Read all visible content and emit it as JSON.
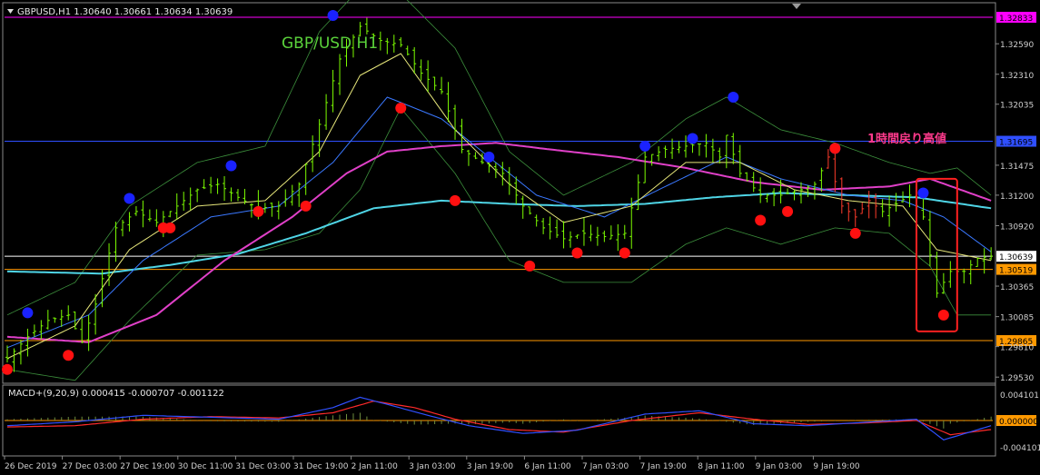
{
  "chart_data": {
    "type": "candlestick",
    "symbol_header": "GBPUSD,H1  1.30640 1.30661 1.30634 1.30639",
    "watermark": "GBP/USD H1",
    "annotation": "1時間戻り高値",
    "ylim": [
      1.2949,
      1.3295
    ],
    "price_ticks": [
      "1.32590",
      "1.32310",
      "1.32035",
      "1.31475",
      "1.31200",
      "1.30920",
      "1.30365",
      "1.30085",
      "1.29810",
      "1.29530"
    ],
    "x_ticks": [
      "26 Dec 2019",
      "27 Dec 03:00",
      "27 Dec 19:00",
      "30 Dec 11:00",
      "31 Dec 03:00",
      "31 Dec 19:00",
      "2 Jan 11:00",
      "3 Jan 03:00",
      "3 Jan 19:00",
      "6 Jan 11:00",
      "7 Jan 03:00",
      "7 Jan 19:00",
      "8 Jan 11:00",
      "9 Jan 03:00",
      "9 Jan 19:00"
    ],
    "horizontal_levels": [
      {
        "label": "1.32833",
        "price": 1.32833,
        "color": "#ff00ff"
      },
      {
        "label": "1.31695",
        "price": 1.31695,
        "color": "#2f4fff"
      },
      {
        "label": "1.30639",
        "price": 1.30639,
        "color": "#ffffff"
      },
      {
        "label": "1.30519",
        "price": 1.30519,
        "color": "#ff9900"
      },
      {
        "label": "1.29865",
        "price": 1.29865,
        "color": "#ff9900"
      }
    ],
    "close_path": [
      [
        0,
        1.297
      ],
      [
        3,
        1.299
      ],
      [
        6,
        1.3005
      ],
      [
        9,
        1.301
      ],
      [
        11,
        1.2985
      ],
      [
        13,
        1.302
      ],
      [
        16,
        1.309
      ],
      [
        19,
        1.3105
      ],
      [
        22,
        1.3095
      ],
      [
        25,
        1.311
      ],
      [
        28,
        1.3125
      ],
      [
        31,
        1.313
      ],
      [
        34,
        1.3118
      ],
      [
        37,
        1.3108
      ],
      [
        40,
        1.311
      ],
      [
        43,
        1.313
      ],
      [
        46,
        1.3185
      ],
      [
        49,
        1.3245
      ],
      [
        52,
        1.3275
      ],
      [
        55,
        1.3262
      ],
      [
        58,
        1.3258
      ],
      [
        61,
        1.3232
      ],
      [
        64,
        1.3215
      ],
      [
        67,
        1.3162
      ],
      [
        70,
        1.315
      ],
      [
        73,
        1.314
      ],
      [
        76,
        1.311
      ],
      [
        79,
        1.309
      ],
      [
        82,
        1.308
      ],
      [
        85,
        1.3085
      ],
      [
        88,
        1.3082
      ],
      [
        91,
        1.3085
      ],
      [
        94,
        1.3155
      ],
      [
        97,
        1.3162
      ],
      [
        100,
        1.3165
      ],
      [
        103,
        1.3168
      ],
      [
        105,
        1.3155
      ],
      [
        106,
        1.3175
      ],
      [
        108,
        1.314
      ],
      [
        111,
        1.312
      ],
      [
        114,
        1.312
      ],
      [
        117,
        1.3125
      ],
      [
        119,
        1.313
      ],
      [
        121,
        1.3155
      ],
      [
        123,
        1.311
      ],
      [
        125,
        1.31
      ],
      [
        127,
        1.3115
      ],
      [
        129,
        1.3105
      ],
      [
        131,
        1.3112
      ],
      [
        133,
        1.312
      ],
      [
        135,
        1.31
      ],
      [
        137,
        1.303
      ],
      [
        139,
        1.305
      ],
      [
        141,
        1.305
      ],
      [
        143,
        1.3062
      ],
      [
        145,
        1.3064
      ]
    ],
    "ma_fast": [
      [
        0,
        1.297
      ],
      [
        10,
        1.3
      ],
      [
        18,
        1.307
      ],
      [
        28,
        1.311
      ],
      [
        38,
        1.3115
      ],
      [
        46,
        1.316
      ],
      [
        52,
        1.323
      ],
      [
        58,
        1.325
      ],
      [
        66,
        1.318
      ],
      [
        74,
        1.313
      ],
      [
        82,
        1.3095
      ],
      [
        92,
        1.311
      ],
      [
        100,
        1.315
      ],
      [
        108,
        1.315
      ],
      [
        116,
        1.3125
      ],
      [
        124,
        1.3115
      ],
      [
        132,
        1.311
      ],
      [
        137,
        1.307
      ],
      [
        145,
        1.306
      ]
    ],
    "ma_blue": [
      [
        0,
        1.298
      ],
      [
        12,
        1.301
      ],
      [
        20,
        1.306
      ],
      [
        30,
        1.31
      ],
      [
        40,
        1.311
      ],
      [
        48,
        1.315
      ],
      [
        56,
        1.321
      ],
      [
        64,
        1.319
      ],
      [
        70,
        1.316
      ],
      [
        78,
        1.312
      ],
      [
        88,
        1.31
      ],
      [
        96,
        1.3125
      ],
      [
        106,
        1.3155
      ],
      [
        114,
        1.3135
      ],
      [
        124,
        1.312
      ],
      [
        132,
        1.3115
      ],
      [
        138,
        1.31
      ],
      [
        145,
        1.3068
      ]
    ],
    "ma_magenta": [
      [
        0,
        1.299
      ],
      [
        12,
        1.2985
      ],
      [
        22,
        1.301
      ],
      [
        32,
        1.306
      ],
      [
        42,
        1.31
      ],
      [
        50,
        1.314
      ],
      [
        56,
        1.316
      ],
      [
        64,
        1.3165
      ],
      [
        72,
        1.3168
      ],
      [
        80,
        1.3162
      ],
      [
        90,
        1.3155
      ],
      [
        100,
        1.3145
      ],
      [
        110,
        1.3132
      ],
      [
        120,
        1.3125
      ],
      [
        130,
        1.3128
      ],
      [
        136,
        1.3135
      ],
      [
        145,
        1.3115
      ]
    ],
    "ma_cyan": [
      [
        0,
        1.305
      ],
      [
        14,
        1.3048
      ],
      [
        24,
        1.3056
      ],
      [
        34,
        1.3066
      ],
      [
        44,
        1.3085
      ],
      [
        54,
        1.3108
      ],
      [
        64,
        1.3115
      ],
      [
        74,
        1.3112
      ],
      [
        84,
        1.311
      ],
      [
        94,
        1.3112
      ],
      [
        104,
        1.3118
      ],
      [
        114,
        1.3122
      ],
      [
        124,
        1.312
      ],
      [
        134,
        1.3118
      ],
      [
        145,
        1.3108
      ]
    ],
    "bb_upper": [
      [
        0,
        1.301
      ],
      [
        10,
        1.304
      ],
      [
        18,
        1.311
      ],
      [
        28,
        1.315
      ],
      [
        38,
        1.3165
      ],
      [
        46,
        1.327
      ],
      [
        52,
        1.331
      ],
      [
        58,
        1.3305
      ],
      [
        66,
        1.3255
      ],
      [
        74,
        1.316
      ],
      [
        82,
        1.312
      ],
      [
        92,
        1.315
      ],
      [
        100,
        1.319
      ],
      [
        106,
        1.321
      ],
      [
        114,
        1.318
      ],
      [
        122,
        1.3168
      ],
      [
        130,
        1.315
      ],
      [
        136,
        1.314
      ],
      [
        140,
        1.3145
      ],
      [
        145,
        1.312
      ]
    ],
    "bb_lower": [
      [
        0,
        1.296
      ],
      [
        10,
        1.295
      ],
      [
        18,
        1.3005
      ],
      [
        28,
        1.3065
      ],
      [
        38,
        1.307
      ],
      [
        46,
        1.3085
      ],
      [
        52,
        1.3125
      ],
      [
        58,
        1.32
      ],
      [
        66,
        1.314
      ],
      [
        74,
        1.306
      ],
      [
        82,
        1.304
      ],
      [
        92,
        1.304
      ],
      [
        100,
        1.3075
      ],
      [
        106,
        1.309
      ],
      [
        114,
        1.3075
      ],
      [
        122,
        1.309
      ],
      [
        130,
        1.3085
      ],
      [
        136,
        1.3055
      ],
      [
        140,
        1.301
      ],
      [
        145,
        1.301
      ]
    ],
    "swing_highs": [
      [
        3,
        1.3012
      ],
      [
        18,
        1.3117
      ],
      [
        33,
        1.3147
      ],
      [
        48,
        1.3285
      ],
      [
        71,
        1.3155
      ],
      [
        94,
        1.3165
      ],
      [
        101,
        1.3172
      ],
      [
        107,
        1.321
      ],
      [
        122,
        1.3163
      ],
      [
        135,
        1.3122
      ]
    ],
    "swing_lows": [
      [
        0,
        1.296
      ],
      [
        9,
        1.2973
      ],
      [
        23,
        1.309
      ],
      [
        24,
        1.309
      ],
      [
        37,
        1.3105
      ],
      [
        44,
        1.311
      ],
      [
        58,
        1.32
      ],
      [
        66,
        1.3115
      ],
      [
        77,
        1.3055
      ],
      [
        84,
        1.3067
      ],
      [
        91,
        1.3067
      ],
      [
        111,
        1.3097
      ],
      [
        115,
        1.3105
      ],
      [
        122,
        1.3163
      ],
      [
        125,
        1.3085
      ],
      [
        138,
        1.301
      ]
    ],
    "highlight_box": {
      "x_from": 134,
      "x_to": 140,
      "p_from": 1.3135,
      "p_to": 1.2995,
      "color": "#ff2020"
    },
    "macd": {
      "label": "MACD+(9,20,9) 0.000415 -0.000707 -0.001122",
      "ticks": [
        "0.004101",
        "0.000000",
        "-0.004101"
      ],
      "ylim": [
        -0.0052,
        0.0052
      ],
      "macd_line": [
        [
          0,
          -0.0008
        ],
        [
          10,
          -0.0002
        ],
        [
          20,
          0.0008
        ],
        [
          30,
          0.0005
        ],
        [
          40,
          0.0002
        ],
        [
          48,
          0.002
        ],
        [
          52,
          0.0036
        ],
        [
          56,
          0.0025
        ],
        [
          62,
          0.0008
        ],
        [
          68,
          -0.0008
        ],
        [
          76,
          -0.002
        ],
        [
          84,
          -0.0015
        ],
        [
          94,
          0.001
        ],
        [
          102,
          0.0015
        ],
        [
          110,
          -0.0005
        ],
        [
          118,
          -0.0008
        ],
        [
          126,
          -0.0003
        ],
        [
          134,
          0.0002
        ],
        [
          138,
          -0.003
        ],
        [
          145,
          -0.0008
        ]
      ],
      "signal_line": [
        [
          0,
          -0.001
        ],
        [
          10,
          -0.0008
        ],
        [
          20,
          0.0002
        ],
        [
          30,
          0.0006
        ],
        [
          40,
          0.0004
        ],
        [
          48,
          0.0012
        ],
        [
          54,
          0.003
        ],
        [
          60,
          0.002
        ],
        [
          66,
          0.0002
        ],
        [
          74,
          -0.0014
        ],
        [
          82,
          -0.0018
        ],
        [
          92,
          0.0
        ],
        [
          102,
          0.0012
        ],
        [
          110,
          0.0002
        ],
        [
          118,
          -0.0006
        ],
        [
          126,
          -0.0004
        ],
        [
          134,
          0.0
        ],
        [
          139,
          -0.0022
        ],
        [
          145,
          -0.0014
        ]
      ]
    }
  }
}
